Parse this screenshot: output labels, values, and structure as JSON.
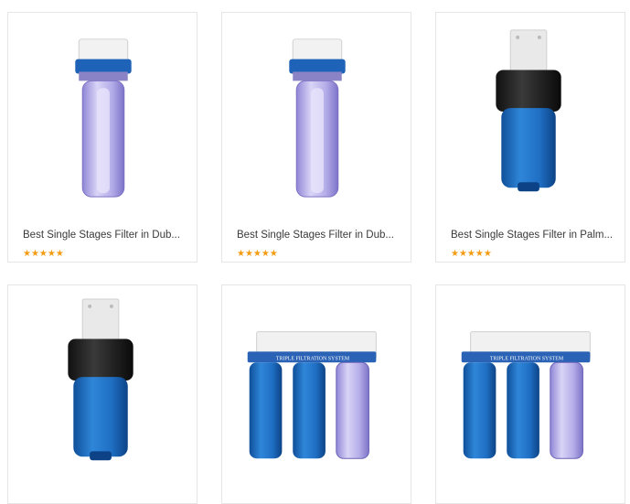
{
  "products": [
    {
      "title": "Best Single Stages Filter in Dub...",
      "rating": 5,
      "image": "clear-single-filter-housing"
    },
    {
      "title": "Best Single Stages Filter in Dub...",
      "rating": 5,
      "image": "clear-single-filter-housing"
    },
    {
      "title": "Best Single Stages Filter in Palm...",
      "rating": 5,
      "image": "blue-single-filter-housing"
    },
    {
      "image": "blue-single-filter-housing"
    },
    {
      "image": "triple-filtration-system"
    },
    {
      "image": "triple-filtration-system"
    }
  ],
  "triple_label": "TRIPLE FILTRATION SYSTEM",
  "colors": {
    "star": "#f39c12",
    "blue": "#1f6fc4",
    "clear": "#b9b3e8"
  }
}
